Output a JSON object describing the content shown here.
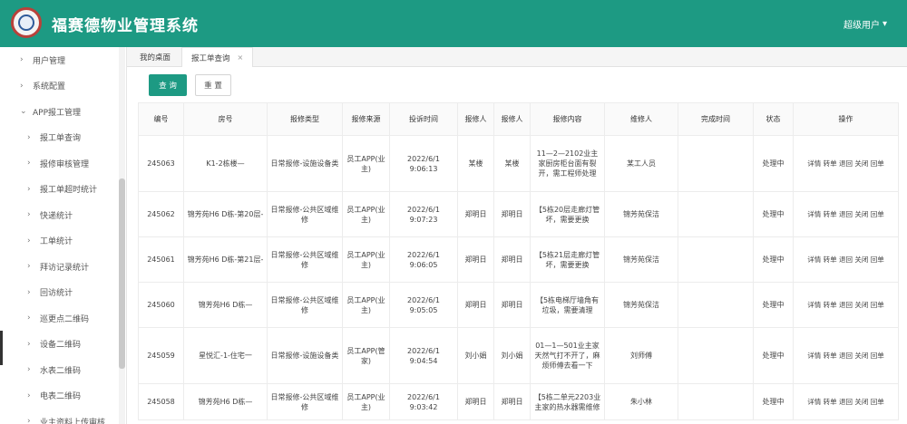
{
  "app": {
    "title": "福赛德物业管理系统",
    "user_label": "超级用户"
  },
  "sidebar": {
    "items": [
      {
        "label": "用户管理",
        "level": 1
      },
      {
        "label": "系统配置",
        "level": 1
      },
      {
        "label": "APP报工管理",
        "level": 1,
        "expanded": true
      },
      {
        "label": "报工单查询",
        "level": 2
      },
      {
        "label": "报修审核管理",
        "level": 2
      },
      {
        "label": "报工单超时统计",
        "level": 2
      },
      {
        "label": "快递统计",
        "level": 2
      },
      {
        "label": "工单统计",
        "level": 2
      },
      {
        "label": "拜访记录统计",
        "level": 2
      },
      {
        "label": "回访统计",
        "level": 2
      },
      {
        "label": "巡更点二维码",
        "level": 2
      },
      {
        "label": "设备二维码",
        "level": 2
      },
      {
        "label": "水表二维码",
        "level": 2
      },
      {
        "label": "电表二维码",
        "level": 2
      },
      {
        "label": "业主资料上传审核",
        "level": 2
      }
    ]
  },
  "tabs": [
    {
      "label": "我的桌面"
    },
    {
      "label": "报工单查询",
      "closable": true,
      "active": true
    }
  ],
  "toolbar": {
    "query_label": "查 询",
    "reset_label": "重 置"
  },
  "table": {
    "headers": [
      "编号",
      "房号",
      "报修类型",
      "报修来源",
      "投诉时间",
      "报修人",
      "报修人",
      "报修内容",
      "维修人",
      "完成时间",
      "状态",
      "操作"
    ],
    "rows": [
      {
        "id": "245063",
        "room": "K1-2栋楼—",
        "type": "日常报修-设施设备类",
        "source": "员工APP(业主)",
        "time": "2022/6/1 9:06:13",
        "p1": "某楼",
        "p2": "某楼",
        "content": "11—2—2102业主家厨房柜台面有裂开，需工程师处理",
        "worker": "某工人员",
        "done": "",
        "status": "处理中",
        "actions": "详情 转单 退回 关闭 回单"
      },
      {
        "id": "245062",
        "room": "锦芳苑H6 D栋-第20层-",
        "type": "日常报修-公共区域维修",
        "source": "员工APP(业主)",
        "time": "2022/6/1 9:07:23",
        "p1": "郑明日",
        "p2": "郑明日",
        "content": "【5栋20层走廊灯管坏，需要更换",
        "worker": "锦芳苑保洁",
        "done": "",
        "status": "处理中",
        "actions": "详情 转单 退回 关闭 回单"
      },
      {
        "id": "245061",
        "room": "锦芳苑H6 D栋-第21层-",
        "type": "日常报修-公共区域维修",
        "source": "员工APP(业主)",
        "time": "2022/6/1 9:06:05",
        "p1": "郑明日",
        "p2": "郑明日",
        "content": "【5栋21层走廊灯管坏，需要更换",
        "worker": "锦芳苑保洁",
        "done": "",
        "status": "处理中",
        "actions": "详情 转单 退回 关闭 回单"
      },
      {
        "id": "245060",
        "room": "锦芳苑H6 D栋—",
        "type": "日常报修-公共区域维修",
        "source": "员工APP(业主)",
        "time": "2022/6/1 9:05:05",
        "p1": "郑明日",
        "p2": "郑明日",
        "content": "【5栋电梯厅墙角有垃圾，需要清理",
        "worker": "锦芳苑保洁",
        "done": "",
        "status": "处理中",
        "actions": "详情 转单 退回 关闭 回单"
      },
      {
        "id": "245059",
        "room": "星悦汇-1-住宅一",
        "type": "日常报修-设施设备类",
        "source": "员工APP(管家)",
        "time": "2022/6/1 9:04:54",
        "p1": "刘小娟",
        "p2": "刘小娟",
        "content": "01—1—501业主家天然气打不开了，麻烦师傅去看一下",
        "worker": "刘师傅",
        "done": "",
        "status": "处理中",
        "actions": "详情 转单 退回 关闭 回单"
      },
      {
        "id": "245058",
        "room": "锦芳苑H6 D栋—",
        "type": "日常报修-公共区域维修",
        "source": "员工APP(业主)",
        "time": "2022/6/1 9:03:42",
        "p1": "郑明日",
        "p2": "郑明日",
        "content": "【5栋二单元2203业主家的热水器需维修",
        "worker": "朱小林",
        "done": "",
        "status": "处理中",
        "actions": "详情 转单 退回 关闭 回单"
      }
    ]
  }
}
